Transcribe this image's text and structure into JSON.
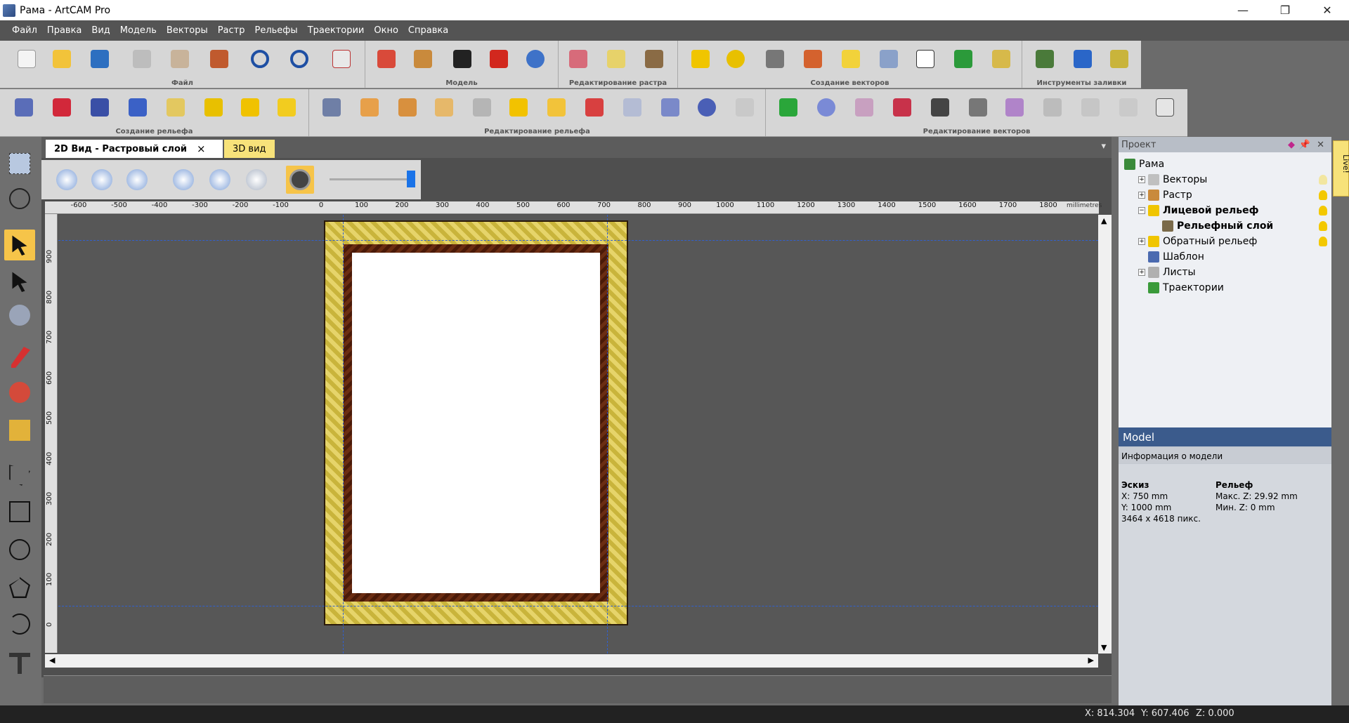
{
  "window": {
    "title": "Рама - ArtCAM Pro",
    "controls": [
      "—",
      "❐",
      "✕"
    ]
  },
  "menu": [
    "Файл",
    "Правка",
    "Вид",
    "Модель",
    "Векторы",
    "Растр",
    "Рельефы",
    "Траектории",
    "Окно",
    "Справка"
  ],
  "toolbar_groups_row1": [
    "Файл",
    "Модель",
    "Редактирование растра",
    "Создание векторов",
    "Инструменты заливки"
  ],
  "toolbar_groups_row2": [
    "Создание рельефа",
    "Редактирование рельефа",
    "Редактирование векторов"
  ],
  "tabs": {
    "active": "2D Вид - Растровый слой",
    "close": "×",
    "other": "3D вид",
    "dropdown": "▾"
  },
  "ruler": {
    "h_ticks": [
      "-600",
      "-500",
      "-400",
      "-300",
      "-200",
      "-100",
      "0",
      "100",
      "200",
      "300",
      "400",
      "500",
      "600",
      "700",
      "800",
      "900",
      "1000",
      "1100",
      "1200",
      "1300",
      "1400",
      "1500",
      "1600",
      "1700",
      "1800"
    ],
    "v_ticks": [
      "900",
      "800",
      "700",
      "600",
      "500",
      "400",
      "300",
      "200",
      "100",
      "0"
    ],
    "units": "millimetres"
  },
  "scroll": {
    "up": "▲",
    "down": "▼",
    "left": "◀",
    "right": "▶"
  },
  "project": {
    "header": "Проект",
    "items": [
      {
        "label": "Рама",
        "level": 0,
        "bold": false,
        "expander": ""
      },
      {
        "label": "Векторы",
        "level": 1,
        "bold": false,
        "expander": "+"
      },
      {
        "label": "Растр",
        "level": 1,
        "bold": false,
        "expander": "+"
      },
      {
        "label": "Лицевой рельеф",
        "level": 1,
        "bold": true,
        "expander": "−"
      },
      {
        "label": "Рельефный слой",
        "level": 2,
        "bold": true,
        "expander": ""
      },
      {
        "label": "Обратный рельеф",
        "level": 1,
        "bold": false,
        "expander": "+"
      },
      {
        "label": "Шаблон",
        "level": 1,
        "bold": false,
        "expander": ""
      },
      {
        "label": "Листы",
        "level": 1,
        "bold": false,
        "expander": "+"
      },
      {
        "label": "Траектории",
        "level": 1,
        "bold": false,
        "expander": ""
      }
    ]
  },
  "model_panel": {
    "title": "Model",
    "info_header": "Информация о модели",
    "sketch": {
      "heading": "Эскиз",
      "x": "X: 750 mm",
      "y": "Y: 1000 mm",
      "pixels": "3464 x 4618 пикс."
    },
    "relief": {
      "heading": "Рельеф",
      "max": "Макс. Z: 29.92 mm",
      "min": "Мин. Z: 0 mm"
    }
  },
  "live_tab": "Live!",
  "status": {
    "x": "X: 814.304",
    "y": "Y: 607.406",
    "z": "Z: 0.000"
  },
  "colors": {
    "menubar": "#545454",
    "accent": "#f6c449",
    "panel_title": "#3b5b8c"
  }
}
